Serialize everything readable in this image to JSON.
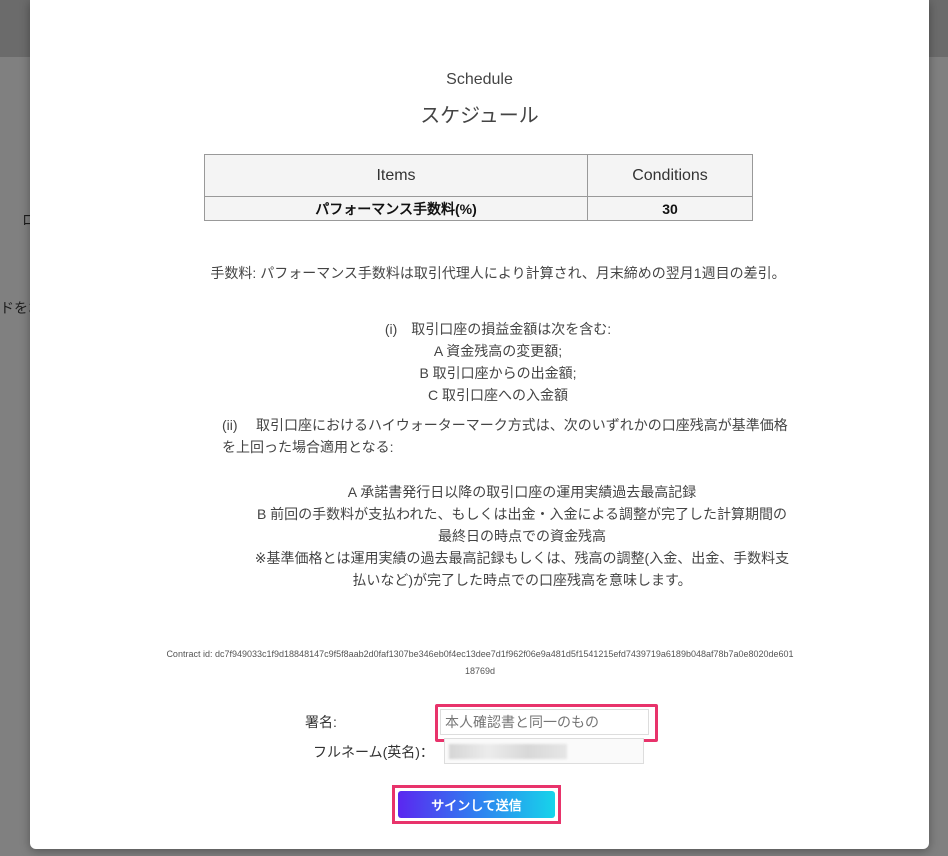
{
  "background": {
    "fragment_1": "ロ",
    "fragment_2": "ドをお"
  },
  "modal": {
    "title_en": "Schedule",
    "title_ja": "スケジュール"
  },
  "table": {
    "headers": [
      "Items",
      "Conditions"
    ],
    "rows": [
      {
        "item": "パフォーマンス手数料(%)",
        "condition": "30"
      }
    ]
  },
  "fee": {
    "description": "手数料: パフォーマンス手数料は取引代理人により計算され、月末締めの翌月1週目の差引。",
    "section_i": {
      "title": "(i)　取引口座の損益金額は次を含む:",
      "items": [
        "A 資金残高の変更額;",
        "B 取引口座からの出金額;",
        "C 取引口座への入金額"
      ]
    },
    "section_ii": {
      "label": "(ii)",
      "text": "取引口座におけるハイウォーターマーク方式は、次のいずれかの口座残高が基準価格を上回った場合適用となる:",
      "items": [
        "A 承諾書発行日以降の取引口座の運用実績過去最高記録",
        "B 前回の手数料が支払われた、もしくは出金・入金による調整が完了した計算期間の最終日の時点での資金残高",
        "※基準価格とは運用実績の過去最高記録もしくは、残高の調整(入金、出金、手数料支払いなど)が完了した時点での口座残高を意味します。"
      ]
    }
  },
  "contract": {
    "label": "Contract id:",
    "id": "dc7f949033c1f9d18848147c9f5f8aab2d0faf1307be346eb0f4ec13dee7d1f962f06e9a481d5f1541215efd7439719a6189b048af78b7a0e8020de60118769d"
  },
  "form": {
    "signature_label": "署名:",
    "signature_placeholder": "本人確認書と同一のもの",
    "fullname_label": "フルネーム(英名)：",
    "fullname_value": "",
    "submit_label": "サインして送信"
  },
  "colors": {
    "highlight_border": "#e8336b",
    "button_gradient_start": "#5b27f0",
    "button_gradient_end": "#17d4ea"
  }
}
